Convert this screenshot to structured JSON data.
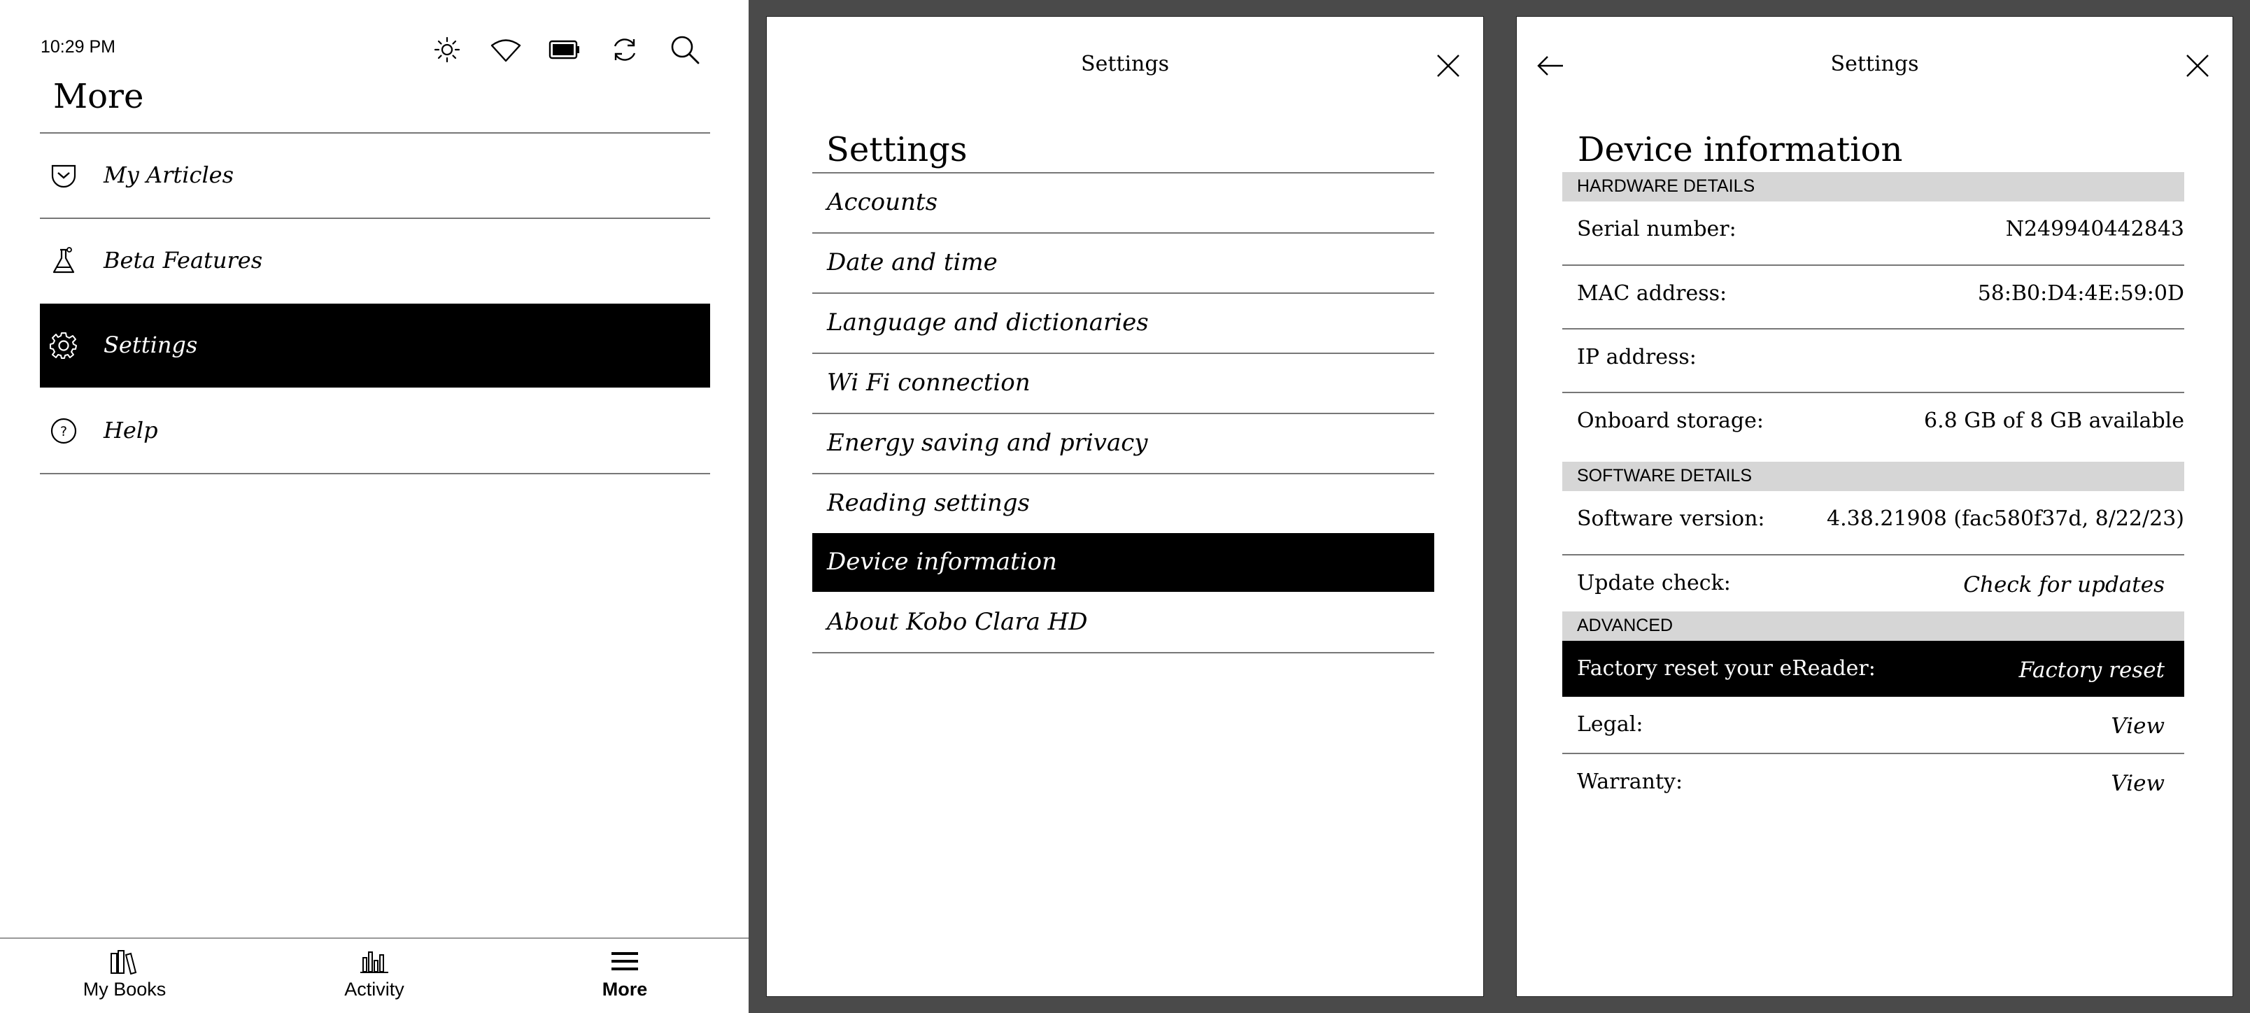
{
  "panel_more": {
    "status": {
      "time": "10:29 PM"
    },
    "status_icons": [
      "brightness-icon",
      "wifi-icon",
      "battery-icon",
      "sync-icon",
      "search-icon"
    ],
    "title": "More",
    "menu": [
      {
        "label": "My Articles",
        "icon": "pocket-icon",
        "active": false
      },
      {
        "label": "Beta Features",
        "icon": "flask-icon",
        "active": false
      },
      {
        "label": "Settings",
        "icon": "gear-icon",
        "active": true
      },
      {
        "label": "Help",
        "icon": "help-icon",
        "active": false
      }
    ],
    "tabs": [
      {
        "label": "My Books",
        "icon": "books-icon",
        "active": false
      },
      {
        "label": "Activity",
        "icon": "activity-chart-icon",
        "active": false
      },
      {
        "label": "More",
        "icon": "menu-icon",
        "active": true
      }
    ]
  },
  "panel_settings": {
    "header_title": "Settings",
    "heading": "Settings",
    "items": [
      {
        "label": "Accounts",
        "active": false
      },
      {
        "label": "Date and time",
        "active": false
      },
      {
        "label": "Language and dictionaries",
        "active": false
      },
      {
        "label": "Wi Fi connection",
        "active": false
      },
      {
        "label": "Energy saving and privacy",
        "active": false
      },
      {
        "label": "Reading settings",
        "active": false
      },
      {
        "label": "Device information",
        "active": true
      },
      {
        "label": "About Kobo Clara HD",
        "active": false
      }
    ]
  },
  "panel_device": {
    "header_title": "Settings",
    "heading": "Device information",
    "hardware": {
      "title": "HARDWARE DETAILS",
      "serial_label": "Serial number:",
      "serial_value": "N249940442843",
      "mac_label": "MAC address:",
      "mac_value": "58:B0:D4:4E:59:0D",
      "ip_label": "IP address:",
      "ip_value": "",
      "storage_label": "Onboard storage:",
      "storage_value": "6.8 GB of 8 GB available"
    },
    "software": {
      "title": "SOFTWARE DETAILS",
      "version_label": "Software version:",
      "version_value": "4.38.21908 (fac580f37d, 8/22/23)",
      "update_label": "Update check:",
      "update_action": "Check for updates"
    },
    "advanced": {
      "title": "ADVANCED",
      "reset_label": "Factory reset your eReader:",
      "reset_action": "Factory reset",
      "legal_label": "Legal:",
      "legal_action": "View",
      "warranty_label": "Warranty:",
      "warranty_action": "View"
    }
  }
}
